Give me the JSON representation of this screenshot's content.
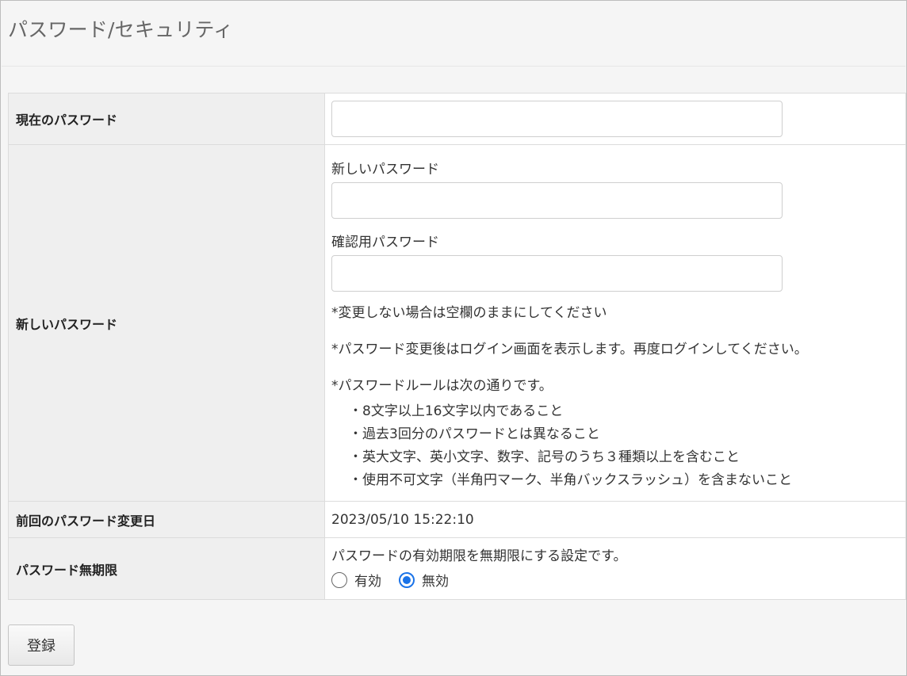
{
  "page": {
    "title": "パスワード/セキュリティ"
  },
  "form": {
    "current_password": {
      "label": "現在のパスワード",
      "value": ""
    },
    "new_password": {
      "label": "新しいパスワード",
      "new_field_label": "新しいパスワード",
      "new_value": "",
      "confirm_field_label": "確認用パスワード",
      "confirm_value": "",
      "note_no_change": "*変更しない場合は空欄のままにしてください",
      "note_relogin": "*パスワード変更後はログイン画面を表示します。再度ログインしてください。",
      "note_rules_heading": "*パスワードルールは次の通りです。",
      "rules": [
        "・8文字以上16文字以内であること",
        "・過去3回分のパスワードとは異なること",
        "・英大文字、英小文字、数字、記号のうち３種類以上を含むこと",
        "・使用不可文字（半角円マーク、半角バックスラッシュ）を含まないこと"
      ]
    },
    "last_change": {
      "label": "前回のパスワード変更日",
      "value": "2023/05/10 15:22:10"
    },
    "unlimited": {
      "label": "パスワード無期限",
      "description": "パスワードの有効期限を無期限にする設定です。",
      "options": [
        {
          "label": "有効",
          "checked": false
        },
        {
          "label": "無効",
          "checked": true
        }
      ]
    }
  },
  "actions": {
    "submit_label": "登録"
  },
  "colors": {
    "radio_accent": "#1a73e8",
    "header_bg": "#f5f5f5",
    "label_cell_bg": "#efefef"
  }
}
